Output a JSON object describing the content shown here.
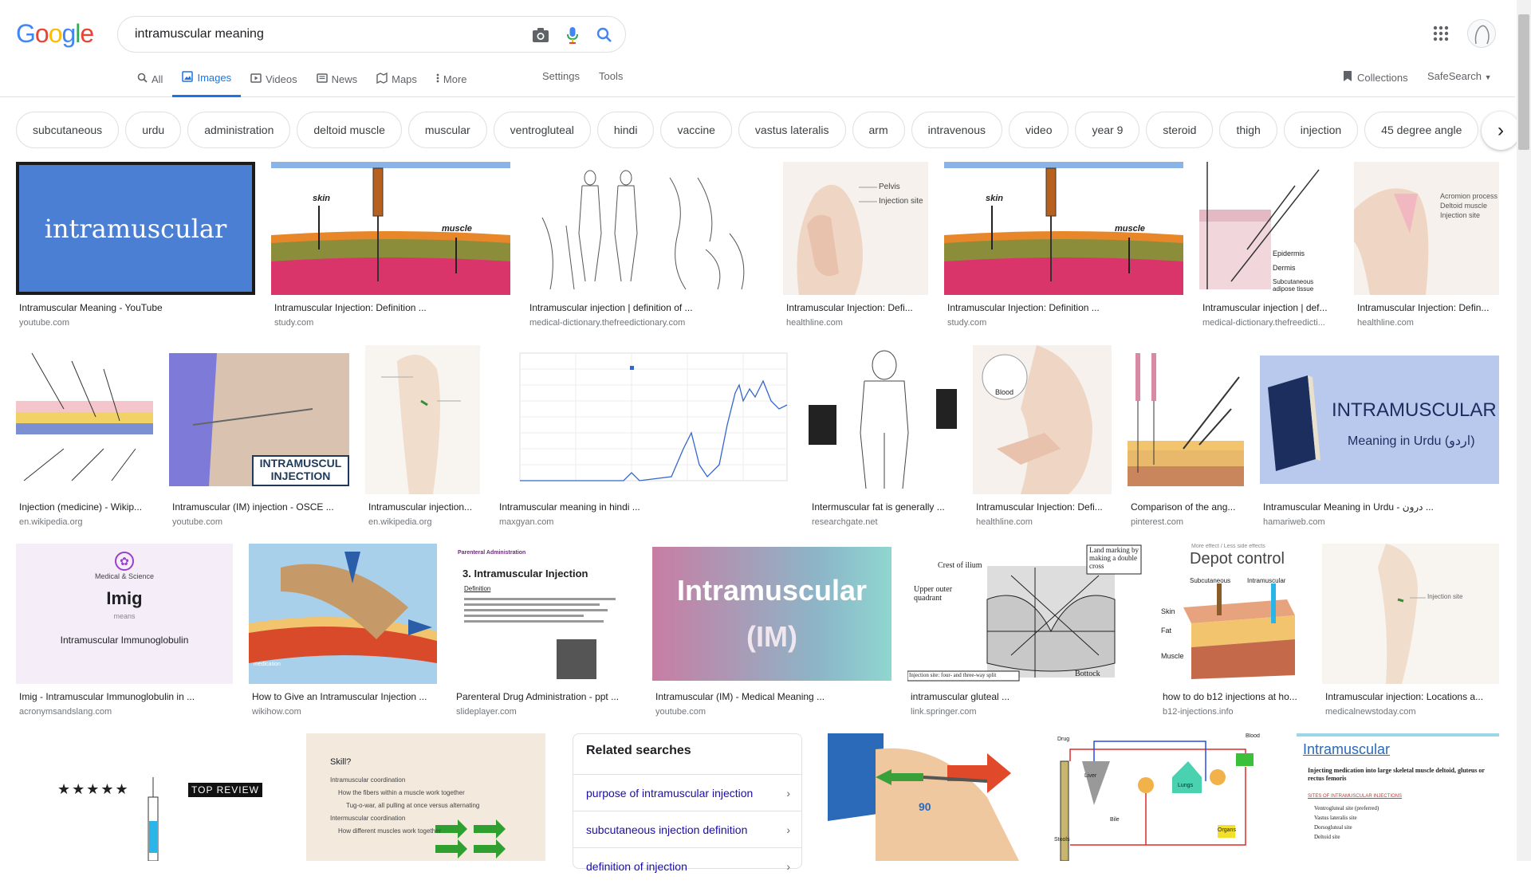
{
  "logo": {
    "letters": [
      "G",
      "o",
      "o",
      "g",
      "l",
      "e"
    ],
    "colors": [
      "#4285f4",
      "#ea4335",
      "#fbbc05",
      "#4285f4",
      "#34a853",
      "#ea4335"
    ]
  },
  "search": {
    "query": "intramuscular meaning"
  },
  "tabs": [
    {
      "label": "All",
      "icon": "search-icon"
    },
    {
      "label": "Images",
      "icon": "image-icon",
      "active": true
    },
    {
      "label": "Videos",
      "icon": "video-icon"
    },
    {
      "label": "News",
      "icon": "news-icon"
    },
    {
      "label": "Maps",
      "icon": "map-icon"
    },
    {
      "label": "More",
      "icon": "dots-icon"
    }
  ],
  "tools": {
    "settings": "Settings",
    "tools": "Tools"
  },
  "right": {
    "collections": "Collections",
    "safesearch": "SafeSearch"
  },
  "chips": [
    "subcutaneous",
    "urdu",
    "administration",
    "deltoid muscle",
    "muscular",
    "ventrogluteal",
    "hindi",
    "vaccine",
    "vastus lateralis",
    "arm",
    "intravenous",
    "video",
    "year 9",
    "steroid",
    "thigh",
    "injection",
    "45 degree angle"
  ],
  "results": [
    {
      "caption": "Intramuscular Meaning - YouTube",
      "source": "youtube.com",
      "thumb_text": "intramuscular",
      "bg": "#4a7fd4"
    },
    {
      "caption": "Intramuscular Injection: Definition ...",
      "source": "study.com",
      "thumb_labels": [
        "skin",
        "muscle"
      ],
      "bg": "#ffffff"
    },
    {
      "caption": "Intramuscular injection | definition of ...",
      "source": "medical-dictionary.thefreedictionary.com",
      "bg": "#ffffff"
    },
    {
      "caption": "Intramuscular Injection: Defi...",
      "source": "healthline.com",
      "thumb_labels": [
        "Pelvis",
        "Injection site"
      ],
      "bg": "#f6f1ec"
    },
    {
      "caption": "Intramuscular Injection: Definition ...",
      "source": "study.com",
      "thumb_labels": [
        "skin",
        "muscle"
      ],
      "bg": "#ffffff"
    },
    {
      "caption": "Intramuscular injection | def...",
      "source": "medical-dictionary.thefreedicti...",
      "thumb_labels": [
        "Epidermis",
        "Dermis",
        "Subcutaneous adipose tissue"
      ],
      "bg": "#ffffff"
    },
    {
      "caption": "Intramuscular Injection: Defin...",
      "source": "healthline.com",
      "thumb_labels": [
        "Acromion process",
        "Deltoid muscle",
        "Injection site"
      ],
      "bg": "#f6f1ec"
    },
    {
      "caption": "Injection (medicine) - Wikip...",
      "source": "en.wikipedia.org",
      "bg": "#ffffff"
    },
    {
      "caption": "Intramuscular (IM) injection - OSCE ...",
      "source": "youtube.com",
      "thumb_text": "INTRAMUSCUL INJECTION",
      "bg": "#d9c3b0"
    },
    {
      "caption": "Intramuscular injection...",
      "source": "en.wikipedia.org",
      "bg": "#f8f4f0"
    },
    {
      "caption": "Intramuscular meaning in hindi ...",
      "source": "maxgyan.com",
      "bg": "#ffffff"
    },
    {
      "caption": "Intermuscular fat is generally ...",
      "source": "researchgate.net",
      "bg": "#ffffff"
    },
    {
      "caption": "Intramuscular Injection: Defi...",
      "source": "healthline.com",
      "thumb_labels": [
        "Blood"
      ],
      "bg": "#f6f1ec"
    },
    {
      "caption": "Comparison of the ang...",
      "source": "pinterest.com",
      "bg": "#ffffff"
    },
    {
      "caption": "Intramuscular Meaning in Urdu - درون ...",
      "source": "hamariweb.com",
      "thumb_text": "INTRAMUSCULAR",
      "thumb_sub": "Meaning in Urdu (اردو)",
      "bg": "#b9c9ee"
    },
    {
      "caption": "Imig - Intramuscular Immunoglobulin in ...",
      "source": "acronymsandslang.com",
      "thumb_text": "Imig",
      "thumb_sub": "Intramuscular Immunoglobulin",
      "thumb_top": "Medical & Science",
      "thumb_means": "means",
      "bg": "#f5eef8"
    },
    {
      "caption": "How to Give an Intramuscular Injection ...",
      "source": "wikihow.com",
      "thumb_labels": [
        "medication"
      ],
      "bg": "#a8d0ea"
    },
    {
      "caption": "Parenteral Drug Administration - ppt ...",
      "source": "slideplayer.com",
      "thumb_title": "3. Intramuscular Injection",
      "thumb_head": "Parenteral Administration",
      "thumb_def": "Definition",
      "bg": "#ffffff"
    },
    {
      "caption": "Intramuscular (IM) - Medical Meaning ...",
      "source": "youtube.com",
      "thumb_text": "Intramuscular",
      "thumb_sub": "(IM)",
      "bg": "#c88aa8"
    },
    {
      "caption": "intramuscular gluteal ...",
      "source": "link.springer.com",
      "thumb_labels": [
        "Crest of ilium",
        "Upper outer quadrant",
        "Bottock",
        "Land marking by making a double cross",
        "Injection site: four- and three-way split"
      ],
      "bg": "#ffffff"
    },
    {
      "caption": "how to do b12 injections at ho...",
      "source": "b12-injections.info",
      "thumb_text": "Depot control",
      "thumb_labels": [
        "More effect / Less side effects",
        "Subcutaneous",
        "Intramuscular",
        "Skin",
        "Fat",
        "Muscle"
      ],
      "bg": "#ffffff"
    },
    {
      "caption": "Intramuscular injection: Locations a...",
      "source": "medicalnewstoday.com",
      "thumb_labels": [
        "Injection site"
      ],
      "bg": "#f8f4f0"
    },
    {
      "thumb_labels": [
        "★★★★★",
        "TOP REVIEW"
      ],
      "bg": "#ffffff"
    },
    {
      "thumb_labels": [
        "Skill?",
        "Intramuscular coordination",
        "How the fibers within a muscle work together",
        "Tug-o-war, all pulling at once versus alternating",
        "Intermuscular coordination",
        "How different muscles work together"
      ],
      "bg": "#f3e9dc"
    },
    {
      "thumb_labels": [
        "90"
      ],
      "bg": "#ffffff"
    },
    {
      "thumb_labels": [
        "Blood",
        "Drug",
        "Liver",
        "Lungs",
        "Organs",
        "Stools",
        "Bile"
      ],
      "bg": "#ffffff"
    },
    {
      "thumb_text": "Intramuscular",
      "thumb_labels": [
        "Injecting medication into large skeletal muscle deltoid, gluteus or rectus femoris",
        "SITES OF INTRAMUSCULAR INJECTIONS",
        "Ventrogluteal site (preferred)",
        "Vastus lateralis site",
        "Dorsogluteal site",
        "Deltoid site"
      ],
      "bg": "#ffffff"
    }
  ],
  "related": {
    "title": "Related searches",
    "items": [
      "purpose of intramuscular injection",
      "subcutaneous injection definition",
      "definition of injection"
    ]
  }
}
